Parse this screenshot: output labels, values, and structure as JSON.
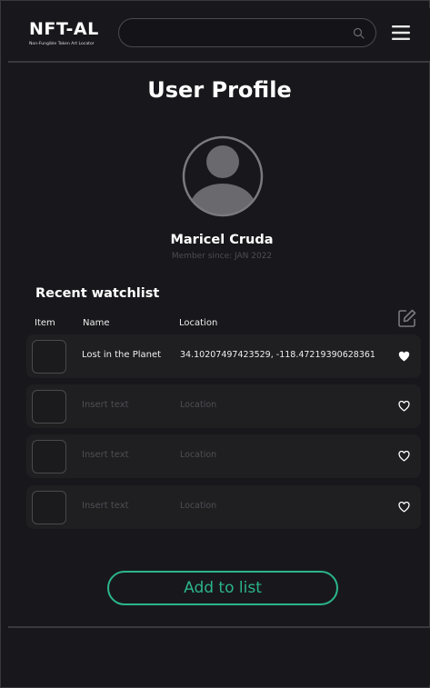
{
  "header": {
    "brand_name": "NFT-AL",
    "brand_tagline": "Non-Fungible Token Art Locator",
    "search_value": "",
    "search_placeholder": ""
  },
  "page_title": "User Profile",
  "profile": {
    "name": "Maricel Cruda",
    "member_since": "Member since: JAN 2022"
  },
  "watchlist": {
    "title": "Recent watchlist",
    "columns": {
      "item": "Item",
      "name": "Name",
      "location": "Location"
    },
    "rows": [
      {
        "name": "Lost in the Planet",
        "location": "34.10207497423529, -118.47219390628361",
        "filled": true
      },
      {
        "name": "Insert text",
        "location": "Location",
        "filled": false
      },
      {
        "name": "Insert text",
        "location": "Location",
        "filled": false
      },
      {
        "name": "Insert text",
        "location": "Location",
        "filled": false
      }
    ]
  },
  "add_button_label": "Add to list",
  "icons": [
    "search-icon",
    "menu-icon",
    "avatar-icon",
    "edit-icon",
    "heart-icon"
  ],
  "colors": {
    "background": "#18181c",
    "accent": "#2bb589",
    "row": "#1f1f22",
    "muted": "#4e4e54"
  }
}
